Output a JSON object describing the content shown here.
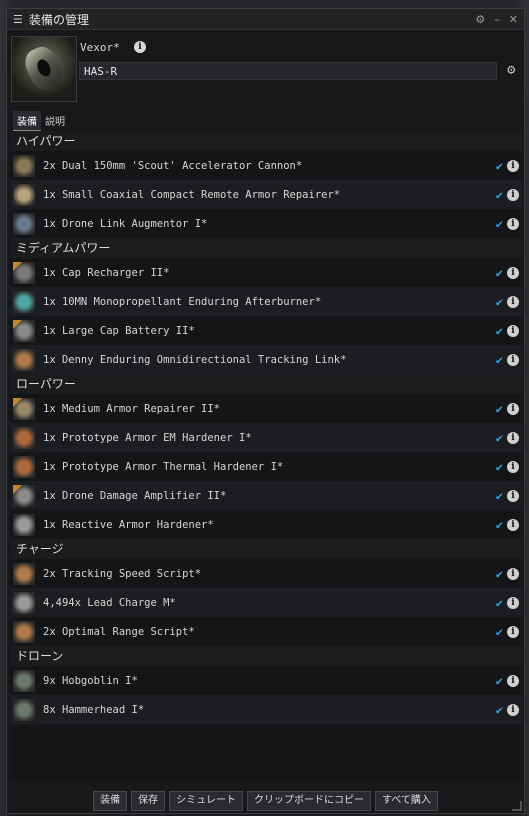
{
  "window": {
    "title": "装備の管理"
  },
  "header": {
    "ship_type": "Vexor*",
    "fitting_name": "HAS-R"
  },
  "tabs": [
    {
      "label": "装備",
      "active": true
    },
    {
      "label": "説明",
      "active": false
    }
  ],
  "sections": [
    {
      "title": "ハイパワー",
      "items": [
        {
          "label": "2x Dual 150mm 'Scout' Accelerator Cannon*",
          "icon": "cannon-icon",
          "t2": false,
          "color": "#8a7a55"
        },
        {
          "label": "1x Small Coaxial Compact Remote Armor Repairer*",
          "icon": "remote-repairer-icon",
          "t2": false,
          "color": "#b8a27a"
        },
        {
          "label": "1x Drone Link Augmentor I*",
          "icon": "drone-link-icon",
          "t2": false,
          "color": "#6b7d95"
        }
      ]
    },
    {
      "title": "ミディアムパワー",
      "items": [
        {
          "label": "1x Cap Recharger II*",
          "icon": "cap-recharger-icon",
          "t2": true,
          "color": "#7a7a7a"
        },
        {
          "label": "1x 10MN Monopropellant Enduring Afterburner*",
          "icon": "afterburner-icon",
          "t2": false,
          "color": "#4fa6a6"
        },
        {
          "label": "1x Large Cap Battery II*",
          "icon": "cap-battery-icon",
          "t2": true,
          "color": "#8a8a8a"
        },
        {
          "label": "1x Denny Enduring Omnidirectional Tracking Link*",
          "icon": "tracking-link-icon",
          "t2": false,
          "color": "#b07a4a"
        }
      ]
    },
    {
      "title": "ローパワー",
      "items": [
        {
          "label": "1x Medium Armor Repairer II*",
          "icon": "armor-repairer-icon",
          "t2": true,
          "color": "#9a8a6a"
        },
        {
          "label": "1x Prototype Armor EM Hardener I*",
          "icon": "em-hardener-icon",
          "t2": false,
          "color": "#b06a3a"
        },
        {
          "label": "1x Prototype Armor Thermal Hardener I*",
          "icon": "thermal-hardener-icon",
          "t2": false,
          "color": "#b06a3a"
        },
        {
          "label": "1x Drone Damage Amplifier II*",
          "icon": "drone-damage-icon",
          "t2": true,
          "color": "#8a8a8a"
        },
        {
          "label": "1x Reactive Armor Hardener*",
          "icon": "reactive-hardener-icon",
          "t2": false,
          "color": "#9a9a9a"
        }
      ]
    },
    {
      "title": "チャージ",
      "items": [
        {
          "label": "2x Tracking Speed Script*",
          "icon": "script-icon",
          "t2": false,
          "color": "#b07a4a"
        },
        {
          "label": "4,494x Lead Charge M*",
          "icon": "ammo-icon",
          "t2": false,
          "color": "#9a9a9a"
        },
        {
          "label": "2x Optimal Range Script*",
          "icon": "script-icon",
          "t2": false,
          "color": "#b07a4a"
        }
      ]
    },
    {
      "title": "ドローン",
      "items": [
        {
          "label": "9x Hobgoblin I*",
          "icon": "hobgoblin-icon",
          "t2": false,
          "color": "#6a7a6a"
        },
        {
          "label": "8x Hammerhead I*",
          "icon": "hammerhead-icon",
          "t2": false,
          "color": "#6a7a6a"
        }
      ]
    }
  ],
  "footer": {
    "buttons": [
      "装備",
      "保存",
      "シミュレート",
      "クリップボードにコピー",
      "すべて購入"
    ]
  }
}
